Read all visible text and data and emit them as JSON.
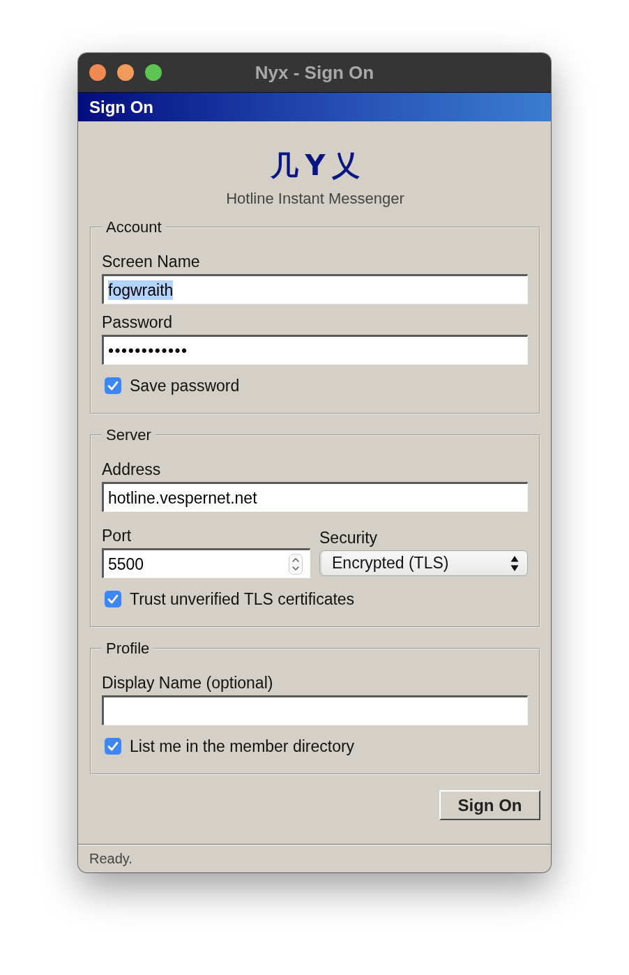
{
  "window": {
    "title": "Nyx - Sign On"
  },
  "header": {
    "title": "Sign On"
  },
  "logo": {
    "mark": "几Y乂",
    "subtitle": "Hotline Instant Messenger"
  },
  "sections": [
    {
      "legend": "Account",
      "rows": [
        {
          "kind": "text",
          "label": "Screen Name",
          "value": "fogwraith",
          "highlighted": true
        },
        {
          "kind": "password",
          "label": "Password",
          "value": "••••••••••••",
          "highlighted": false
        },
        {
          "kind": "checkbox",
          "label": "Save password",
          "checked": true
        }
      ]
    },
    {
      "legend": "Server",
      "rows": [
        {
          "kind": "text",
          "label": "Address",
          "value": "hotline.vespernet.net",
          "highlighted": false
        },
        {
          "kind": "pair",
          "items": [
            {
              "kind": "spinner",
              "label": "Port",
              "value": "5500",
              "highlighted": false
            },
            {
              "kind": "select",
              "label": "Security",
              "value": "Encrypted (TLS)"
            }
          ]
        },
        {
          "kind": "checkbox",
          "label": "Trust unverified TLS certificates",
          "checked": true
        }
      ]
    },
    {
      "legend": "Profile",
      "rows": [
        {
          "kind": "text",
          "label": "Display Name (optional)"
        },
        {
          "kind": "checkbox",
          "label": "List me in the member directory",
          "checked": true
        }
      ]
    }
  ],
  "button": {
    "label": "Sign On"
  },
  "status_bar": {
    "text": "Ready."
  }
}
